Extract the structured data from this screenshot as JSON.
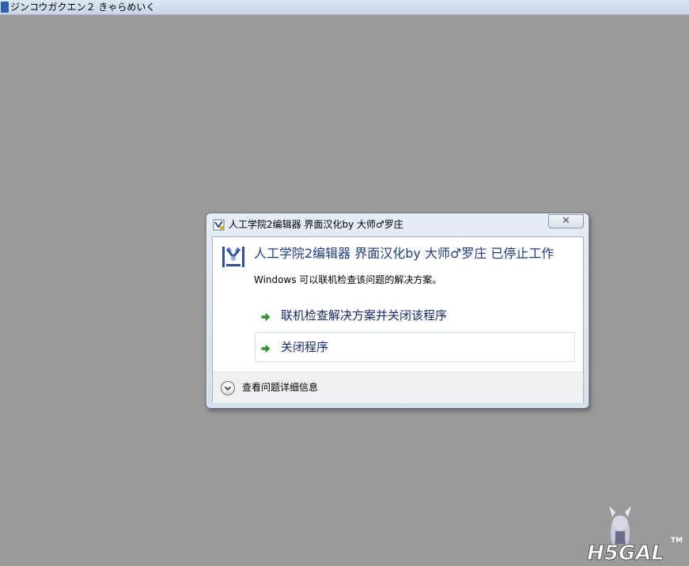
{
  "background_window": {
    "title": "ジンコウガクエン２ きゃらめいく"
  },
  "dialog": {
    "title": "人工学院2编辑器 界面汉化by 大师♂罗庄",
    "close_label": "✕",
    "main_instruction": "人工学院2编辑器 界面汉化by 大师♂罗庄 已停止工作",
    "sub_text": "Windows 可以联机检查该问题的解决方案。",
    "commands": [
      {
        "label": "联机检查解决方案并关闭该程序",
        "icon": "green-arrow-icon"
      },
      {
        "label": "关闭程序",
        "icon": "green-arrow-icon"
      }
    ],
    "details_label": "查看问题详细信息"
  },
  "watermark": {
    "text": "H5GAL",
    "tm": "TM"
  },
  "colors": {
    "desktop": "#9a9a9a",
    "instruction": "#1e3d8f",
    "command_link": "#14297a",
    "arrow": "#2e9a2e"
  }
}
